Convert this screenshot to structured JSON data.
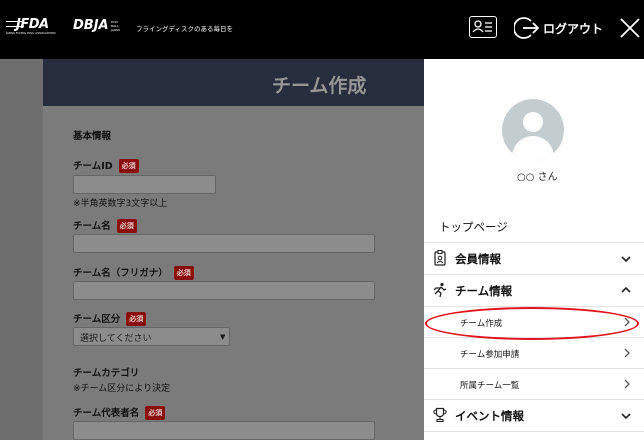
{
  "header": {
    "jfda_logo": "JFDA",
    "jfda_subtext": "JAPAN FLYING DISC ASSOCIATION",
    "dbja_logo": "DBJA",
    "dbja_subtext": "DISC BALL JAPAN",
    "tagline": "フライングディスクのある毎日を",
    "logout_label": "ログアウト",
    "icons": [
      "member-card-icon",
      "logout-icon",
      "close-icon"
    ]
  },
  "background_page": {
    "page_title": "チーム作成",
    "section_title": "基本情報",
    "required_badge": "必須",
    "fields": {
      "team_id_label": "チームID",
      "team_id_note": "※半角英数字3文字以上",
      "team_name_label": "チーム名",
      "team_name_kana_label": "チーム名（フリガナ）",
      "team_type_label": "チーム区分",
      "team_type_select": "選択してください",
      "team_category_label": "チームカテゴリ",
      "team_category_note": "※チーム区分により決定",
      "team_rep_label": "チーム代表者名"
    }
  },
  "drawer": {
    "user_name": "○○ さん",
    "top_page": "トップページ",
    "member_info": "会員情報",
    "team_info": "チーム情報",
    "team_submenu": [
      "チーム作成",
      "チーム参加申請",
      "所属チーム一覧"
    ],
    "event_info": "イベント情報",
    "icons": [
      "id-badge-icon",
      "runner-icon",
      "trophy-icon",
      "chevron-down-icon",
      "chevron-up-icon",
      "chevron-right-icon"
    ],
    "highlight_color": "#e0141b"
  }
}
